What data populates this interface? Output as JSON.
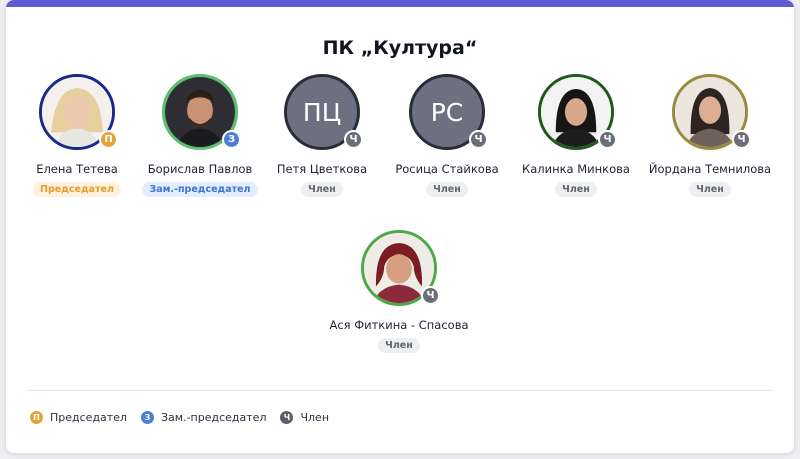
{
  "committee": {
    "title": "ПК „Култура“"
  },
  "colors": {
    "accent": "#5e5bd6",
    "chair": "#e3a33b",
    "deputy": "#4a7fd6",
    "member": "#6a6e78"
  },
  "members": [
    {
      "name": "Елена Тетева",
      "role_label": "Председател",
      "role": "chair",
      "badge": "П",
      "avatar": "photo",
      "ring_color": "#1a2a8c"
    },
    {
      "name": "Борислав Павлов",
      "role_label": "Зам.-председател",
      "role": "deputy",
      "badge": "З",
      "avatar": "photo",
      "ring_color": "#5cbf6e"
    },
    {
      "name": "Петя Цветкова",
      "role_label": "Член",
      "role": "member",
      "badge": "Ч",
      "avatar": "initials",
      "initials": "ПЦ"
    },
    {
      "name": "Росица Стайкова",
      "role_label": "Член",
      "role": "member",
      "badge": "Ч",
      "avatar": "initials",
      "initials": "РС"
    },
    {
      "name": "Калинка Минкова",
      "role_label": "Член",
      "role": "member",
      "badge": "Ч",
      "avatar": "photo",
      "ring_color": "#1f5a1a"
    },
    {
      "name": "Йордана Темнилова",
      "role_label": "Член",
      "role": "member",
      "badge": "Ч",
      "avatar": "photo",
      "ring_color": "#9a8a3c"
    },
    {
      "name": "Ася Фиткина - Спасова",
      "role_label": "Член",
      "role": "member",
      "badge": "Ч",
      "avatar": "photo",
      "ring_color": "#4fa845"
    }
  ],
  "legend": [
    {
      "badge": "П",
      "label": "Председател",
      "role": "chair"
    },
    {
      "badge": "З",
      "label": "Зам.-председател",
      "role": "deputy"
    },
    {
      "badge": "Ч",
      "label": "Член",
      "role": "member"
    }
  ]
}
